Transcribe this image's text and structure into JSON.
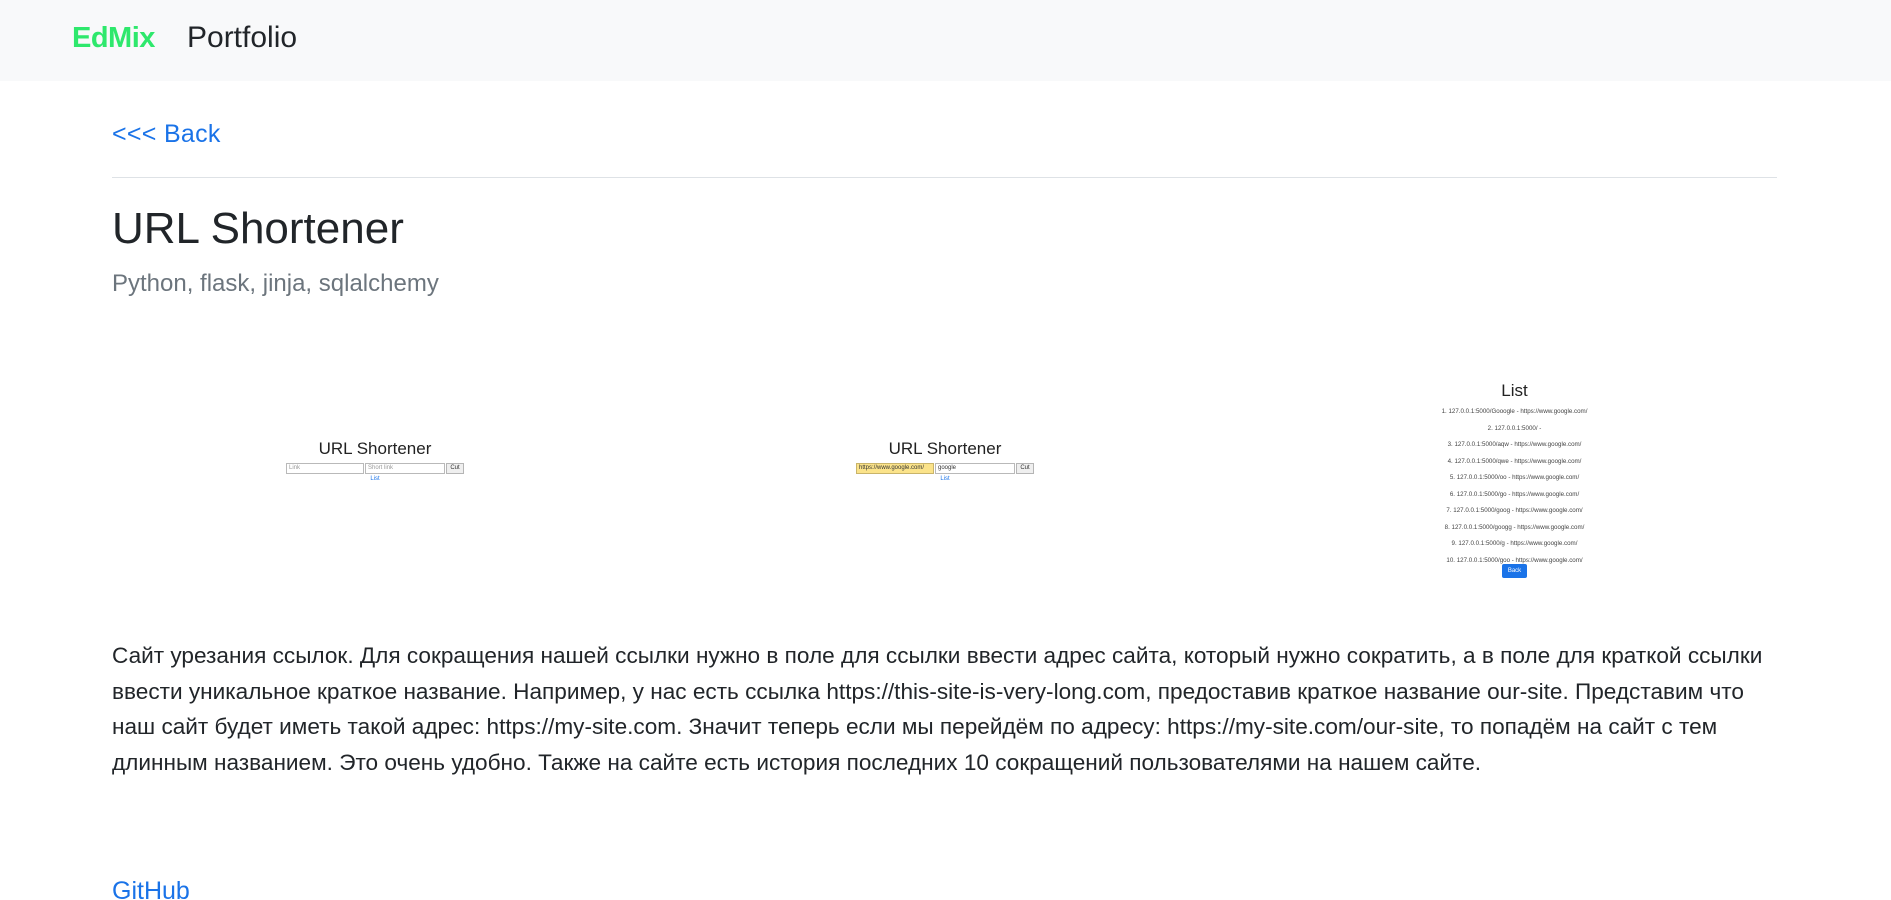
{
  "navbar": {
    "brand": "EdMix",
    "portfolio_label": "Portfolio"
  },
  "back_label": "<<< Back",
  "project": {
    "title": "URL Shortener",
    "stack": "Python, flask, jinja, sqlalchemy",
    "description": "Сайт урезания ссылок. Для сокращения нашей ссылки нужно в поле для ссылки ввести адрес сайта, который нужно сократить, а в поле для краткой ссылки ввести уникальное краткое название. Например, у нас есть ссылка https://this-site-is-very-long.com, предоставив краткое название our-site. Представим что наш сайт будет иметь такой адрес: https://my-site.com. Значит теперь если мы перейдём по адресу: https://my-site.com/our-site, то попадём на сайт с тем длинным названием. Это очень удобно. Также на сайте есть история последних 10 сокращений пользователями на нашем сайте.",
    "github_label": "GitHub"
  },
  "screenshots": {
    "form_empty": {
      "title": "URL Shortener",
      "link_placeholder": "Link",
      "short_placeholder": "Short link",
      "cut_label": "Cut",
      "list_link": "List"
    },
    "form_filled": {
      "title": "URL Shortener",
      "link_value": "https://www.google.com/",
      "short_value": "google",
      "cut_label": "Cut",
      "list_link": "List"
    },
    "list_page": {
      "title": "List",
      "items": [
        "1. 127.0.0.1:5000/Gooogle - https://www.google.com/",
        "2. 127.0.0.1:5000/ -",
        "3. 127.0.0.1:5000/aqw - https://www.google.com/",
        "4. 127.0.0.1:5000/qwe - https://www.google.com/",
        "5. 127.0.0.1:5000/oo - https://www.google.com/",
        "6. 127.0.0.1:5000/go - https://www.google.com/",
        "7. 127.0.0.1:5000/goog - https://www.google.com/",
        "8. 127.0.0.1:5000/googg - https://www.google.com/",
        "9. 127.0.0.1:5000/g - https://www.google.com/",
        "10. 127.0.0.1:5000/goo - https://www.google.com/"
      ],
      "back_label": "Back"
    }
  }
}
